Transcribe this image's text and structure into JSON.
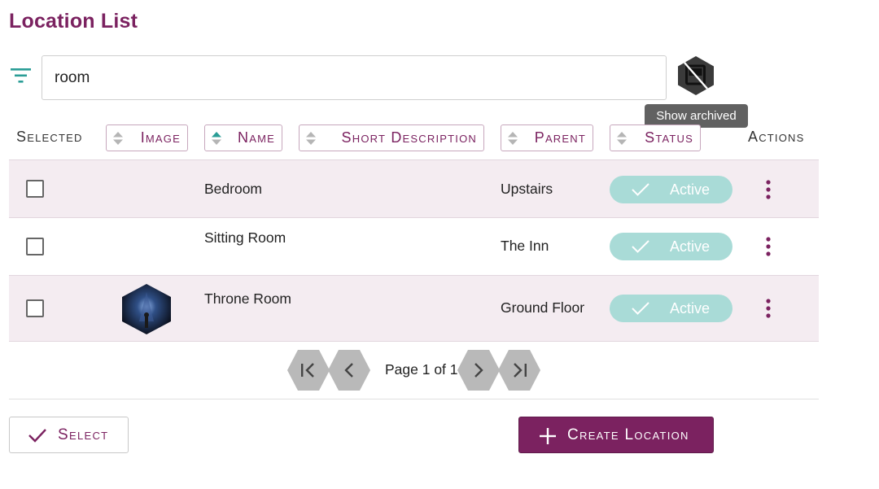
{
  "page": {
    "title": "Location List"
  },
  "search": {
    "value": "room",
    "placeholder": ""
  },
  "archive_toggle": {
    "icon": "archive-toggle-icon",
    "tooltip": "Show archived"
  },
  "columns": {
    "selected": "Selected",
    "image": "Image",
    "name": "Name",
    "short_description": "Short Description",
    "parent": "Parent",
    "status": "Status",
    "actions": "Actions",
    "sorted_by": "name",
    "sort_direction": "ascending"
  },
  "rows": [
    {
      "name": "Bedroom",
      "short_description": "",
      "parent": "Upstairs",
      "status": "Active",
      "has_image": false,
      "checked": false
    },
    {
      "name": "Sitting Room",
      "short_description": "",
      "parent": "The Inn",
      "status": "Active",
      "has_image": false,
      "checked": false
    },
    {
      "name": "Throne Room",
      "short_description": "",
      "parent": "Ground Floor",
      "status": "Active",
      "has_image": true,
      "checked": false
    }
  ],
  "pagination": {
    "label": "Page 1 of 1"
  },
  "footer": {
    "select_label": "Select",
    "create_label": "Create Location"
  },
  "colors": {
    "brand": "#7b2260",
    "teal": "#2a9d96",
    "status_pill": "#a9dbd7",
    "row_shade": "#f4ecf1",
    "pager_hex": "#b9b9b9"
  }
}
